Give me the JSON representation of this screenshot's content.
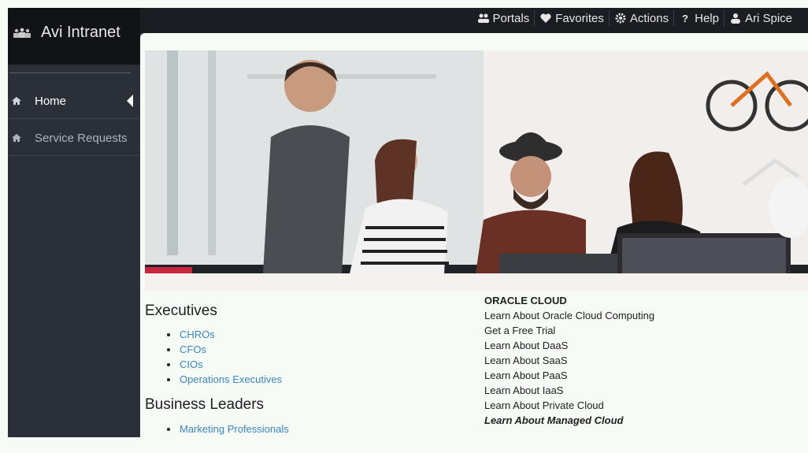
{
  "app": {
    "title": "Avi Intranet",
    "accent": "#3a86c8",
    "sidebar_bg": "#2b2f38",
    "topbar_bg": "#1a1d22"
  },
  "topnav": [
    {
      "label": "Portals",
      "icon": "users-icon"
    },
    {
      "label": "Favorites",
      "icon": "heart-icon"
    },
    {
      "label": "Actions",
      "icon": "gear-icon"
    },
    {
      "label": "Help",
      "icon": "question-icon"
    },
    {
      "label": "Ari Spice",
      "icon": "user-icon"
    }
  ],
  "sidebar": {
    "items": [
      {
        "label": "Home",
        "icon": "home-icon",
        "active": true
      },
      {
        "label": "Service Requests",
        "icon": "home-icon",
        "active": false
      }
    ]
  },
  "hero": {
    "icon": "team-photo"
  },
  "sections": [
    {
      "heading": "Executives",
      "links": [
        "CHROs",
        "CFOs",
        "CIOs",
        "Operations Executives"
      ]
    },
    {
      "heading": "Business Leaders",
      "links": [
        "Marketing Professionals"
      ]
    }
  ],
  "oracle": {
    "heading": "ORACLE CLOUD",
    "links": [
      "Learn About Oracle Cloud Computing",
      "Get a Free Trial",
      "Learn About DaaS",
      "Learn About SaaS",
      "Learn About PaaS",
      "Learn About IaaS",
      "Learn About Private Cloud"
    ],
    "emphasis": "Learn About Managed Cloud"
  }
}
